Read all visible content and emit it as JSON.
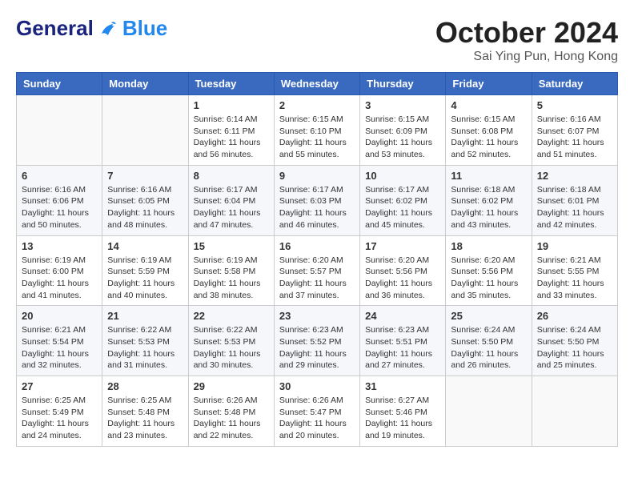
{
  "header": {
    "logo_general": "General",
    "logo_blue": "Blue",
    "month": "October 2024",
    "location": "Sai Ying Pun, Hong Kong"
  },
  "weekdays": [
    "Sunday",
    "Monday",
    "Tuesday",
    "Wednesday",
    "Thursday",
    "Friday",
    "Saturday"
  ],
  "weeks": [
    [
      {
        "day": "",
        "info": ""
      },
      {
        "day": "",
        "info": ""
      },
      {
        "day": "1",
        "info": "Sunrise: 6:14 AM\nSunset: 6:11 PM\nDaylight: 11 hours and 56 minutes."
      },
      {
        "day": "2",
        "info": "Sunrise: 6:15 AM\nSunset: 6:10 PM\nDaylight: 11 hours and 55 minutes."
      },
      {
        "day": "3",
        "info": "Sunrise: 6:15 AM\nSunset: 6:09 PM\nDaylight: 11 hours and 53 minutes."
      },
      {
        "day": "4",
        "info": "Sunrise: 6:15 AM\nSunset: 6:08 PM\nDaylight: 11 hours and 52 minutes."
      },
      {
        "day": "5",
        "info": "Sunrise: 6:16 AM\nSunset: 6:07 PM\nDaylight: 11 hours and 51 minutes."
      }
    ],
    [
      {
        "day": "6",
        "info": "Sunrise: 6:16 AM\nSunset: 6:06 PM\nDaylight: 11 hours and 50 minutes."
      },
      {
        "day": "7",
        "info": "Sunrise: 6:16 AM\nSunset: 6:05 PM\nDaylight: 11 hours and 48 minutes."
      },
      {
        "day": "8",
        "info": "Sunrise: 6:17 AM\nSunset: 6:04 PM\nDaylight: 11 hours and 47 minutes."
      },
      {
        "day": "9",
        "info": "Sunrise: 6:17 AM\nSunset: 6:03 PM\nDaylight: 11 hours and 46 minutes."
      },
      {
        "day": "10",
        "info": "Sunrise: 6:17 AM\nSunset: 6:02 PM\nDaylight: 11 hours and 45 minutes."
      },
      {
        "day": "11",
        "info": "Sunrise: 6:18 AM\nSunset: 6:02 PM\nDaylight: 11 hours and 43 minutes."
      },
      {
        "day": "12",
        "info": "Sunrise: 6:18 AM\nSunset: 6:01 PM\nDaylight: 11 hours and 42 minutes."
      }
    ],
    [
      {
        "day": "13",
        "info": "Sunrise: 6:19 AM\nSunset: 6:00 PM\nDaylight: 11 hours and 41 minutes."
      },
      {
        "day": "14",
        "info": "Sunrise: 6:19 AM\nSunset: 5:59 PM\nDaylight: 11 hours and 40 minutes."
      },
      {
        "day": "15",
        "info": "Sunrise: 6:19 AM\nSunset: 5:58 PM\nDaylight: 11 hours and 38 minutes."
      },
      {
        "day": "16",
        "info": "Sunrise: 6:20 AM\nSunset: 5:57 PM\nDaylight: 11 hours and 37 minutes."
      },
      {
        "day": "17",
        "info": "Sunrise: 6:20 AM\nSunset: 5:56 PM\nDaylight: 11 hours and 36 minutes."
      },
      {
        "day": "18",
        "info": "Sunrise: 6:20 AM\nSunset: 5:56 PM\nDaylight: 11 hours and 35 minutes."
      },
      {
        "day": "19",
        "info": "Sunrise: 6:21 AM\nSunset: 5:55 PM\nDaylight: 11 hours and 33 minutes."
      }
    ],
    [
      {
        "day": "20",
        "info": "Sunrise: 6:21 AM\nSunset: 5:54 PM\nDaylight: 11 hours and 32 minutes."
      },
      {
        "day": "21",
        "info": "Sunrise: 6:22 AM\nSunset: 5:53 PM\nDaylight: 11 hours and 31 minutes."
      },
      {
        "day": "22",
        "info": "Sunrise: 6:22 AM\nSunset: 5:53 PM\nDaylight: 11 hours and 30 minutes."
      },
      {
        "day": "23",
        "info": "Sunrise: 6:23 AM\nSunset: 5:52 PM\nDaylight: 11 hours and 29 minutes."
      },
      {
        "day": "24",
        "info": "Sunrise: 6:23 AM\nSunset: 5:51 PM\nDaylight: 11 hours and 27 minutes."
      },
      {
        "day": "25",
        "info": "Sunrise: 6:24 AM\nSunset: 5:50 PM\nDaylight: 11 hours and 26 minutes."
      },
      {
        "day": "26",
        "info": "Sunrise: 6:24 AM\nSunset: 5:50 PM\nDaylight: 11 hours and 25 minutes."
      }
    ],
    [
      {
        "day": "27",
        "info": "Sunrise: 6:25 AM\nSunset: 5:49 PM\nDaylight: 11 hours and 24 minutes."
      },
      {
        "day": "28",
        "info": "Sunrise: 6:25 AM\nSunset: 5:48 PM\nDaylight: 11 hours and 23 minutes."
      },
      {
        "day": "29",
        "info": "Sunrise: 6:26 AM\nSunset: 5:48 PM\nDaylight: 11 hours and 22 minutes."
      },
      {
        "day": "30",
        "info": "Sunrise: 6:26 AM\nSunset: 5:47 PM\nDaylight: 11 hours and 20 minutes."
      },
      {
        "day": "31",
        "info": "Sunrise: 6:27 AM\nSunset: 5:46 PM\nDaylight: 11 hours and 19 minutes."
      },
      {
        "day": "",
        "info": ""
      },
      {
        "day": "",
        "info": ""
      }
    ]
  ]
}
